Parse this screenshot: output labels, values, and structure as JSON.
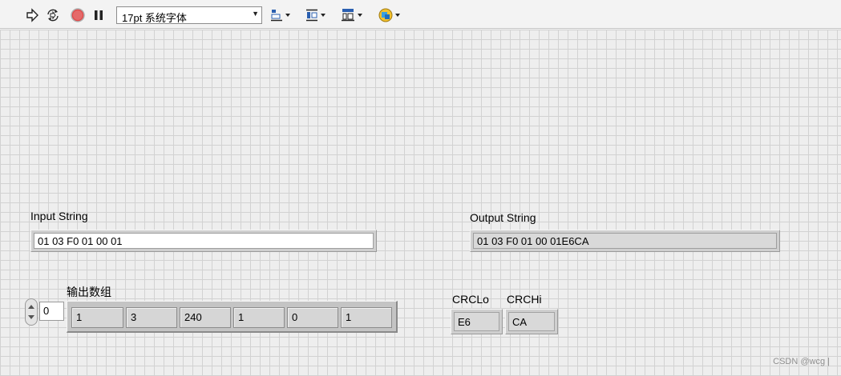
{
  "toolbar": {
    "font_value": "17pt 系统字体",
    "buttons": [
      {
        "name": "run-arrow-icon"
      },
      {
        "name": "run-continuously-icon"
      },
      {
        "name": "abort-icon"
      },
      {
        "name": "pause-icon"
      },
      {
        "name": "align-objects-icon"
      },
      {
        "name": "distribute-objects-icon"
      },
      {
        "name": "resize-objects-icon"
      },
      {
        "name": "reorder-icon"
      }
    ]
  },
  "front_panel": {
    "input_string": {
      "label": "Input String",
      "value": "01 03 F0 01 00 01"
    },
    "output_string": {
      "label": "Output String",
      "value": "01 03 F0 01 00 01E6CA"
    },
    "output_array": {
      "label": "输出数组",
      "index": "0",
      "elements": [
        "1",
        "3",
        "240",
        "1",
        "0",
        "1"
      ]
    },
    "crc_lo": {
      "label": "CRCLo",
      "value": "E6"
    },
    "crc_hi": {
      "label": "CRCHi",
      "value": "CA"
    }
  },
  "watermark": "CSDN @wcg |",
  "colors": {
    "abort_red": "#e04848",
    "grid_line": "#d2d2d2",
    "panel_bg": "#eeeeee"
  }
}
